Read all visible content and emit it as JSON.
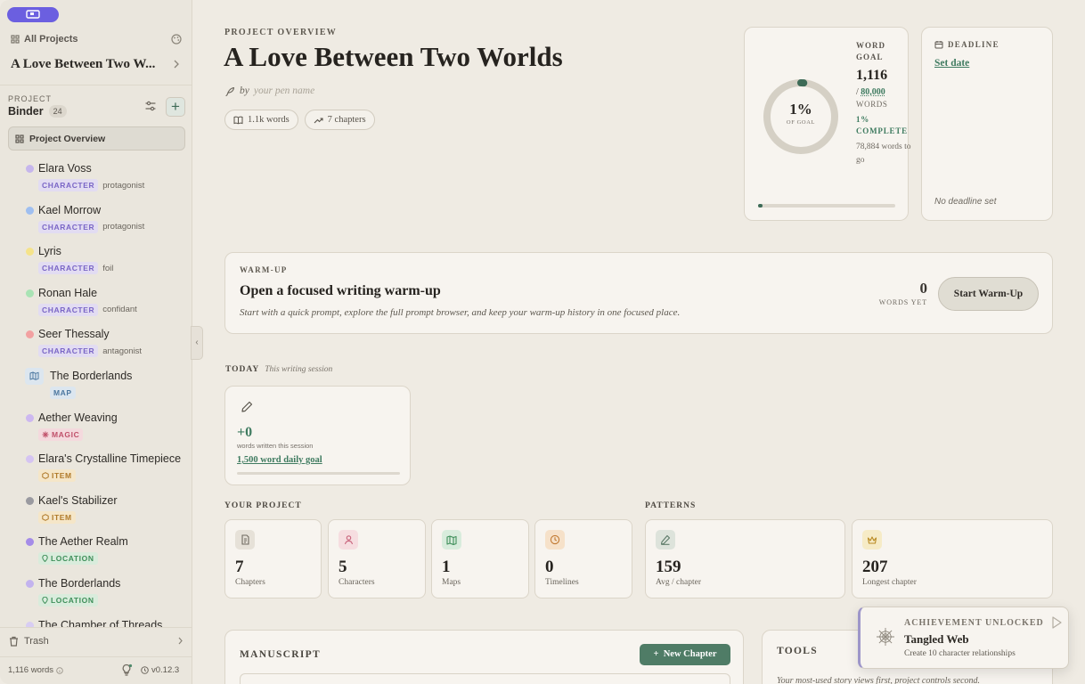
{
  "sidebar": {
    "all_projects": "All Projects",
    "project_title": "A Love Between Two W...",
    "section_label": "PROJECT",
    "binder_label": "Binder",
    "binder_count": "24",
    "overview": "Project Overview",
    "items": [
      {
        "name": "Elara Voss",
        "badge": "CHARACTER",
        "role": "protagonist",
        "kind": "character",
        "dot": "#c6b6ec"
      },
      {
        "name": "Kael Morrow",
        "badge": "CHARACTER",
        "role": "protagonist",
        "kind": "character",
        "dot": "#9fbff0"
      },
      {
        "name": "Lyris",
        "badge": "CHARACTER",
        "role": "foil",
        "kind": "character",
        "dot": "#f5e38a"
      },
      {
        "name": "Ronan Hale",
        "badge": "CHARACTER",
        "role": "confidant",
        "kind": "character",
        "dot": "#a9e3b4"
      },
      {
        "name": "Seer Thessaly",
        "badge": "CHARACTER",
        "role": "antagonist",
        "kind": "character",
        "dot": "#f2a1a1"
      },
      {
        "name": "The Borderlands",
        "badge": "MAP",
        "role": "",
        "kind": "map",
        "dot": ""
      },
      {
        "name": "Aether Weaving",
        "badge": "MAGIC",
        "role": "",
        "kind": "magic",
        "dot": "#cdb8f0"
      },
      {
        "name": "Elara's Crystalline Timepiece",
        "badge": "ITEM",
        "role": "",
        "kind": "item",
        "dot": "#d5c4f2"
      },
      {
        "name": "Kael's Stabilizer",
        "badge": "ITEM",
        "role": "",
        "kind": "item",
        "dot": "#9a9aa0"
      },
      {
        "name": "The Aether Realm",
        "badge": "LOCATION",
        "role": "",
        "kind": "location",
        "dot": "#a58ce8"
      },
      {
        "name": "The Borderlands",
        "badge": "LOCATION",
        "role": "",
        "kind": "location",
        "dot": "#c3b3ee"
      },
      {
        "name": "The Chamber of Threads",
        "badge": "",
        "role": "",
        "kind": "location",
        "dot": "#d8cdf3"
      }
    ],
    "trash": "Trash",
    "word_count": "1,116 words",
    "version": "v0.12.3"
  },
  "header": {
    "eyebrow": "PROJECT OVERVIEW",
    "title": "A Love Between Two Worlds",
    "by": "by",
    "pen_placeholder": "your pen name",
    "chip_words": "1.1k words",
    "chip_chapters": "7 chapters"
  },
  "goal": {
    "label": "WORD GOAL",
    "percent_text": "1%",
    "of_goal": "OF GOAL",
    "current": "1,116",
    "slash": "/",
    "target": "80,000",
    "words": "WORDS",
    "complete": "1% COMPLETE",
    "to_go": "78,884 words to go",
    "progress": 0.014
  },
  "deadline": {
    "label": "DEADLINE",
    "set_date": "Set date",
    "none": "No deadline set"
  },
  "warmup": {
    "eyebrow": "WARM-UP",
    "title": "Open a focused writing warm-up",
    "subtitle": "Start with a quick prompt, explore the full prompt browser, and keep your warm-up history in one focused place.",
    "count": "0",
    "count_label": "WORDS YET",
    "button": "Start Warm-Up"
  },
  "today": {
    "label": "TODAY",
    "sub": "This writing session",
    "count": "+0",
    "count_label": "words written this session",
    "goal_link": "1,500 word daily goal",
    "progress": 0
  },
  "project_stats": {
    "label": "YOUR PROJECT",
    "items": [
      {
        "value": "7",
        "label": "Chapters",
        "icon": "document-icon"
      },
      {
        "value": "5",
        "label": "Characters",
        "icon": "person-icon"
      },
      {
        "value": "1",
        "label": "Maps",
        "icon": "map-icon"
      },
      {
        "value": "0",
        "label": "Timelines",
        "icon": "clock-icon"
      }
    ]
  },
  "patterns": {
    "label": "PATTERNS",
    "items": [
      {
        "value": "159",
        "label": "Avg / chapter",
        "icon": "pencil-icon"
      },
      {
        "value": "207",
        "label": "Longest chapter",
        "icon": "crown-icon"
      }
    ]
  },
  "manuscript": {
    "title": "MANUSCRIPT",
    "new_chapter": "New Chapter"
  },
  "tools": {
    "title": "TOOLS",
    "subtitle": "Your most-used story views first, project controls second."
  },
  "toast": {
    "kicker": "ACHIEVEMENT UNLOCKED",
    "title": "Tangled Web",
    "desc": "Create 10 character relationships"
  },
  "colors": {
    "accent_green": "#3f7b60",
    "brand_purple": "#6b5fe0",
    "background": "#efebe3"
  }
}
